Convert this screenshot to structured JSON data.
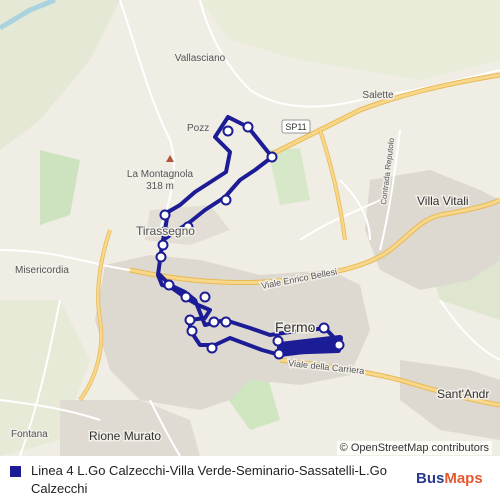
{
  "map": {
    "places": {
      "vallasciano": "Vallasciano",
      "salette": "Salette",
      "pozzetto": "Pozz",
      "montagnola": "La Montagnola",
      "montagnola_elev": "318 m",
      "tirassegno": "Tirassegno",
      "misericordia": "Misericordia",
      "fermo": "Fermo",
      "villa_vitali": "Villa Vitali",
      "sant_andrea": "Sant'Andr",
      "fontana": "Fontana",
      "rione_murato": "Rione Murato"
    },
    "roads": {
      "sp11": "SP11",
      "contrada_reputolo": "Contrada Reputolo",
      "viale_bellesi": "Viale Enrico Bellesi",
      "viale_carriera": "Viale della Carriera"
    },
    "route_color": "#1c1c96",
    "attribution": "© OpenStreetMap contributors"
  },
  "legend": {
    "line_label": "Linea 4 L.Go Calzecchi-Villa Verde-Seminario-Sassatelli-L.Go Calzecchi",
    "brand_part1": "Bus",
    "brand_part2": "Maps"
  }
}
